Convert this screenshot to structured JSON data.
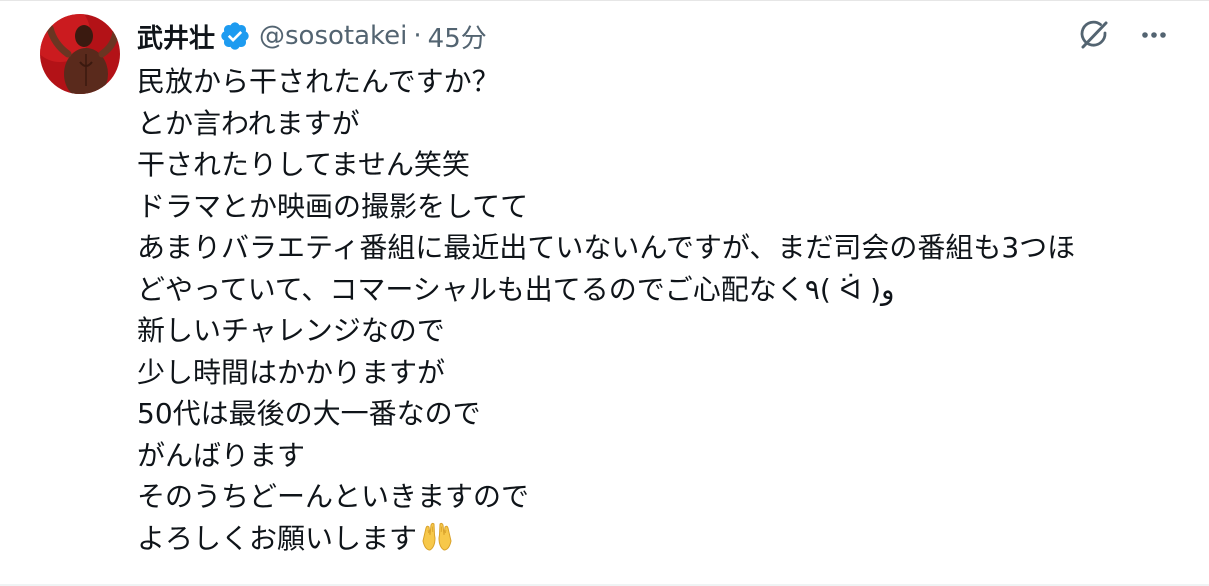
{
  "tweet": {
    "author": {
      "display_name": "武井壮",
      "handle": "@sosotakei",
      "verified": true,
      "avatar_icon": "avatar-photo"
    },
    "separator": "·",
    "timestamp": "45分",
    "actions": {
      "grok_icon": "grok-icon",
      "more_icon": "more-dots-icon"
    },
    "lines": [
      "民放から干されたんですか？",
      "とか言われますが",
      "干されたりしてません笑笑",
      "ドラマとか映画の撮影をしてて",
      "あまりバラエティ番組に最近出ていないんですが、まだ司会の番組も3つほ",
      "どやっていて、コマーシャルも出てるのでご心配なく٩( ᐛ )و",
      "新しいチャレンジなので",
      "少し時間はかかりますが",
      "50代は最後の大一番なので",
      "がんばります",
      "そのうちどーんといきますので",
      "よろしくお願いします"
    ],
    "trailing_emoji": "raising-hands-emoji"
  },
  "colors": {
    "text": "#0f1419",
    "secondary": "#536471",
    "verified_badge": "#1d9bf0",
    "emoji_yellow": "#f7c84a"
  }
}
